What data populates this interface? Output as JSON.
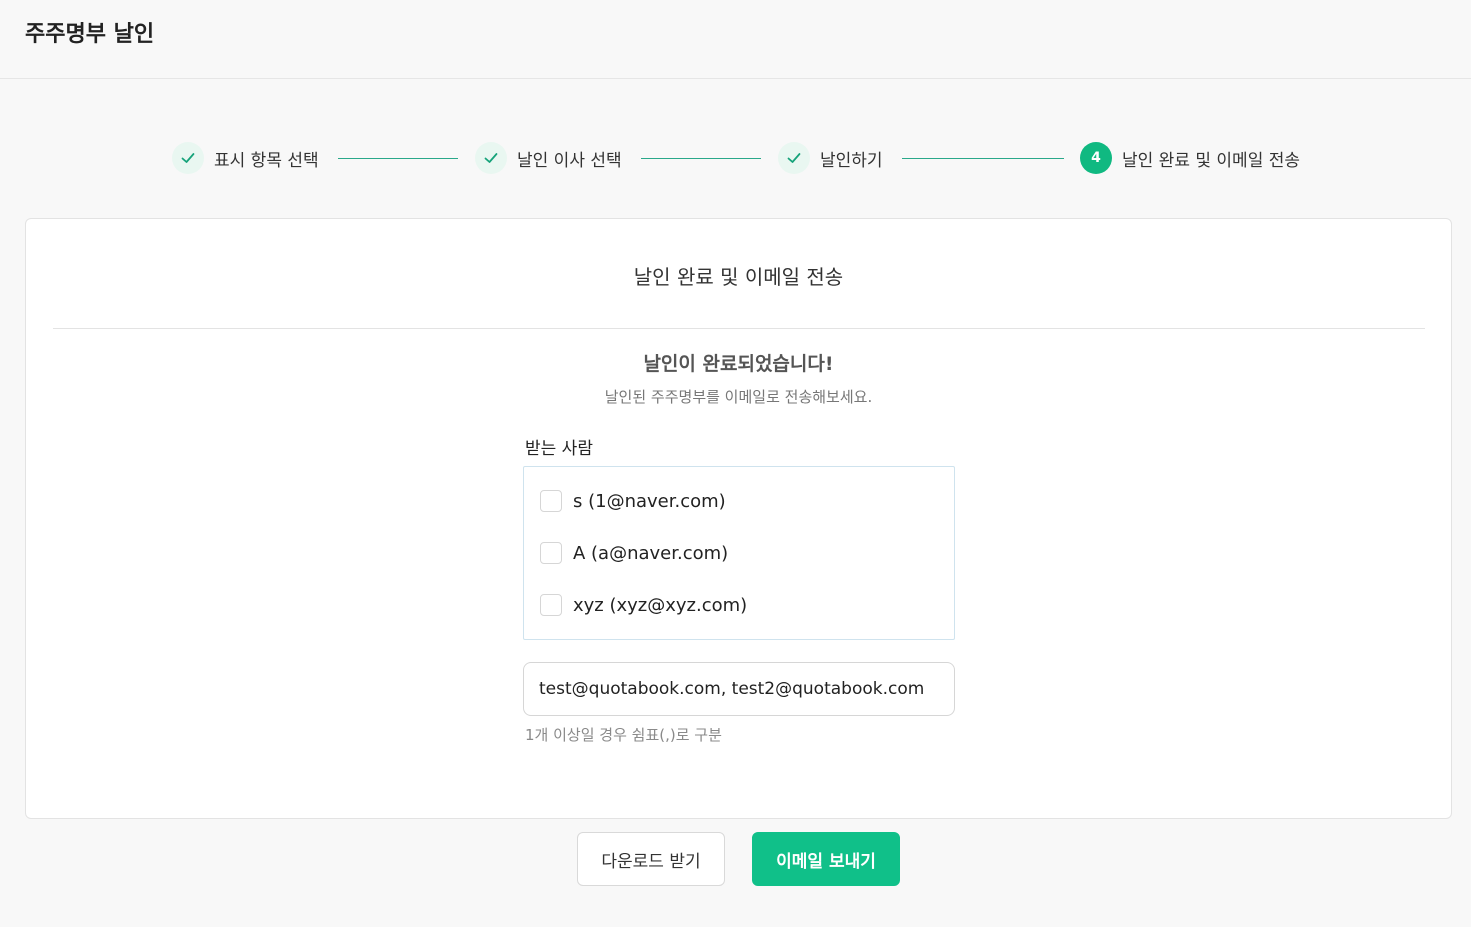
{
  "header": {
    "title": "주주명부 날인"
  },
  "stepper": {
    "steps": [
      {
        "label": "표시 항목 선택",
        "status": "done",
        "icon": "check-icon"
      },
      {
        "label": "날인 이사 선택",
        "status": "done",
        "icon": "check-icon"
      },
      {
        "label": "날인하기",
        "status": "done",
        "icon": "check-icon"
      },
      {
        "label": "날인 완료 및 이메일 전송",
        "status": "active",
        "number": "4"
      }
    ],
    "accent_color": "#10b981"
  },
  "card": {
    "title": "날인 완료 및 이메일 전송",
    "success_title": "날인이 완료되었습니다!",
    "success_sub": "날인된 주주명부를 이메일로 전송해보세요.",
    "recipient_label": "받는 사람",
    "recipients": [
      {
        "text": "s (1@naver.com)",
        "checked": false
      },
      {
        "text": "A (a@naver.com)",
        "checked": false
      },
      {
        "text": "xyz (xyz@xyz.com)",
        "checked": false
      }
    ],
    "email_input_value": "test@quotabook.com, test2@quotabook.com",
    "helper": "1개 이상일 경우 쉼표(,)로 구분"
  },
  "actions": {
    "download_label": "다운로드 받기",
    "send_label": "이메일 보내기"
  }
}
